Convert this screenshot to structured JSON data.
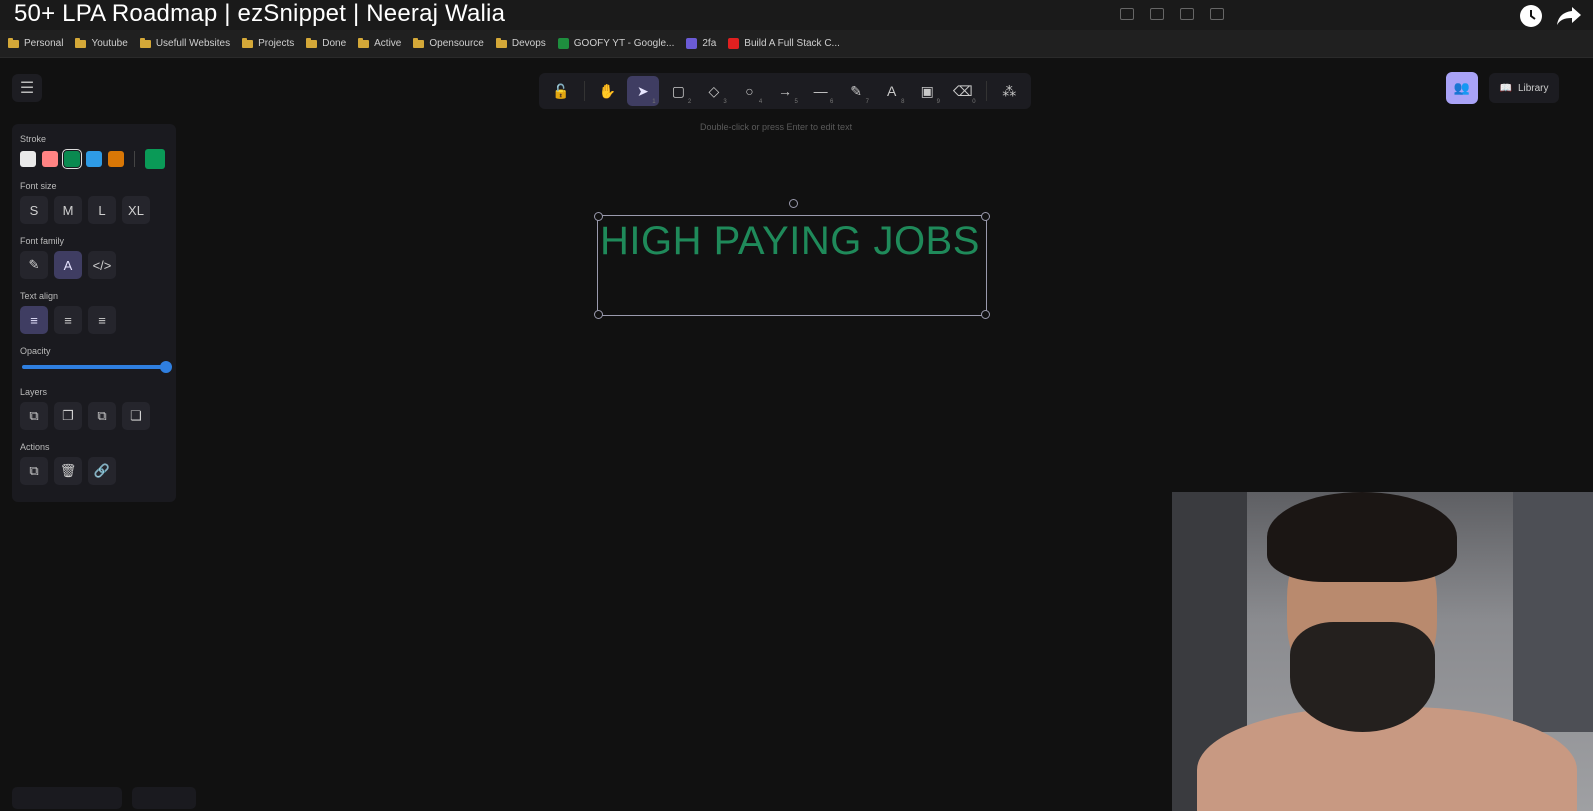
{
  "video": {
    "title": "50+ LPA Roadmap | ezSnippet | Neeraj Walia"
  },
  "bookmarks": [
    {
      "label": "Personal",
      "kind": "folder"
    },
    {
      "label": "Youtube",
      "kind": "folder"
    },
    {
      "label": "Usefull Websites",
      "kind": "folder"
    },
    {
      "label": "Projects",
      "kind": "folder"
    },
    {
      "label": "Done",
      "kind": "folder"
    },
    {
      "label": "Active",
      "kind": "folder"
    },
    {
      "label": "Opensource",
      "kind": "folder"
    },
    {
      "label": "Devops",
      "kind": "folder"
    },
    {
      "label": "GOOFY YT - Google...",
      "kind": "sheets"
    },
    {
      "label": "2fa",
      "kind": "app"
    },
    {
      "label": "Build A Full Stack C...",
      "kind": "youtube"
    }
  ],
  "toolbar": {
    "tools": [
      {
        "name": "lock-icon",
        "glyph": "🔓",
        "key": ""
      },
      {
        "name": "hand-icon",
        "glyph": "✋",
        "key": ""
      },
      {
        "name": "selection-icon",
        "glyph": "➤",
        "key": "1",
        "active": true
      },
      {
        "name": "rectangle-icon",
        "glyph": "▢",
        "key": "2"
      },
      {
        "name": "diamond-icon",
        "glyph": "◇",
        "key": "3"
      },
      {
        "name": "ellipse-icon",
        "glyph": "○",
        "key": "4"
      },
      {
        "name": "arrow-icon",
        "glyph": "→",
        "key": "5"
      },
      {
        "name": "line-icon",
        "glyph": "—",
        "key": "6"
      },
      {
        "name": "pencil-icon",
        "glyph": "✎",
        "key": "7"
      },
      {
        "name": "text-icon",
        "glyph": "A",
        "key": "8"
      },
      {
        "name": "image-icon",
        "glyph": "▣",
        "key": "9"
      },
      {
        "name": "eraser-icon",
        "glyph": "⌫",
        "key": "0"
      },
      {
        "name": "shapes-library-icon",
        "glyph": "⁂",
        "key": ""
      }
    ],
    "hint": "Double-click or press Enter to edit text"
  },
  "header": {
    "library_label": "Library"
  },
  "properties": {
    "stroke_label": "Stroke",
    "stroke_colors": [
      "#e9e9e9",
      "#ff8383",
      "#0a8a50",
      "#2e9be6",
      "#d97706"
    ],
    "stroke_selected_index": 2,
    "stroke_current": "#0a9a57",
    "font_size_label": "Font size",
    "font_sizes": [
      "S",
      "M",
      "L",
      "XL"
    ],
    "font_family_label": "Font family",
    "text_align_label": "Text align",
    "opacity_label": "Opacity",
    "opacity_value": 100,
    "layers_label": "Layers",
    "actions_label": "Actions"
  },
  "canvas": {
    "text": "HIGH PAYING JOBS",
    "text_color": "#1f8a5a"
  },
  "colors": {
    "accent": "#3f3d62",
    "collab": "#a9a3f7",
    "slider": "#2f7fe0"
  }
}
